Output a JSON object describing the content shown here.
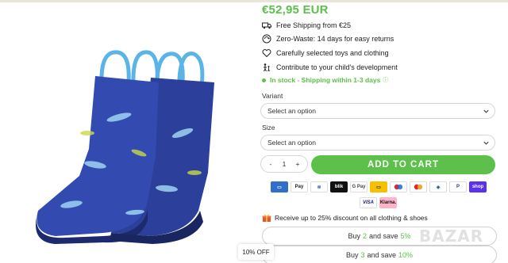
{
  "price": "€52,95 EUR",
  "features": [
    {
      "icon": "truck-icon",
      "text": "Free Shipping from €25"
    },
    {
      "icon": "recycle-icon",
      "text": "Zero-Waste: 14 days for easy returns"
    },
    {
      "icon": "heart-icon",
      "text": "Carefully selected toys and clothing"
    },
    {
      "icon": "child-icon",
      "text": "Contribute to your child's development"
    }
  ],
  "stock": {
    "text": "In stock - Shipping within 1-3 days",
    "info_icon": "info-icon"
  },
  "variant": {
    "label": "Variant",
    "placeholder": "Select an option"
  },
  "size": {
    "label": "Size",
    "placeholder": "Select an option"
  },
  "quantity": {
    "minus": "-",
    "value": "1",
    "plus": "+"
  },
  "add_to_cart": "ADD TO CART",
  "payments_row1": [
    "Amex",
    "Apple Pay",
    "Bancontact",
    "blik",
    "G Pay",
    "iDEAL",
    "Maestro",
    "Mastercard",
    "EPS",
    "PayPal",
    "shop"
  ],
  "payments_row2": [
    "VISA",
    "Klarna."
  ],
  "promo": "Receive up to 25% discount on all clothing & shoes",
  "bundles": [
    {
      "pre": "Buy",
      "num": "2",
      "mid": "and save",
      "pct": "5%"
    },
    {
      "pre": "Buy",
      "num": "3",
      "mid": "and save",
      "pct": "10%"
    }
  ],
  "discount_badge": "10% OFF",
  "watermark": "BAZAR",
  "colors": {
    "accent": "#5cc04a",
    "boot_blue": "#2a3f9e",
    "handle_blue": "#5ab4e6"
  }
}
